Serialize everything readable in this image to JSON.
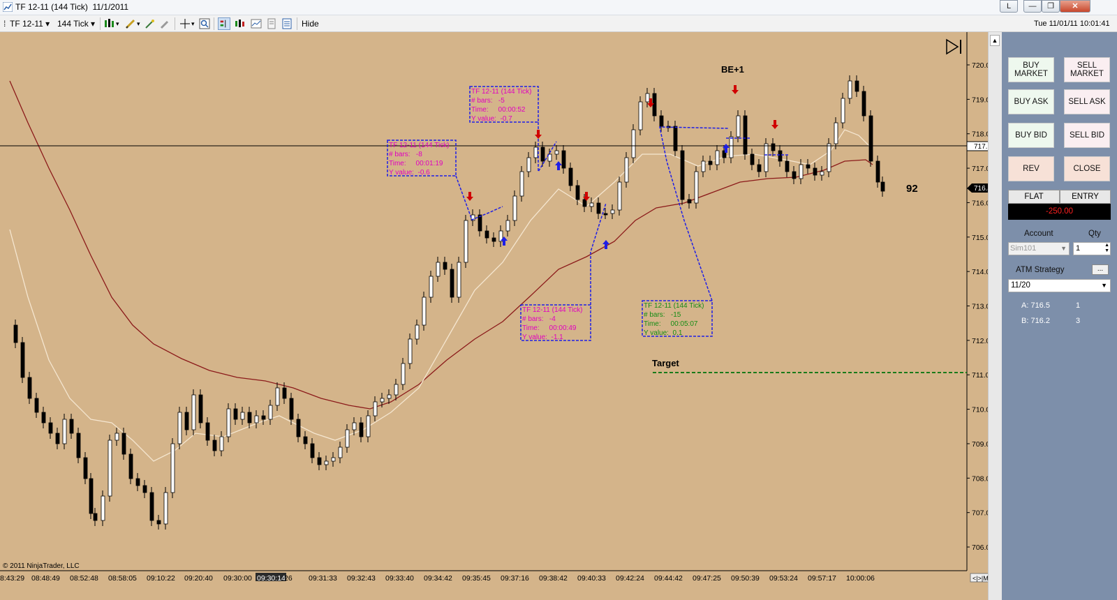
{
  "window": {
    "title": "TF 12-11 (144 Tick)  11/1/2011",
    "buttons": {
      "layout": "L",
      "minimize": "—",
      "maximize": "❐",
      "close": "✕"
    }
  },
  "toolbar": {
    "instrument": "TF 12-11",
    "interval": "144 Tick",
    "hide_label": "Hide",
    "datetime": "Tue 11/01/11 10:01:41"
  },
  "chart": {
    "copyright": "© 2011 NinjaTrader, LLC",
    "price_ticks": [
      "720.0",
      "719.0",
      "718.0",
      "717.0",
      "716.0",
      "715.0",
      "714.0",
      "713.0",
      "712.0",
      "711.0",
      "710.0",
      "709.0",
      "708.0",
      "707.0",
      "706.0"
    ],
    "time_ticks": [
      "8:43:29",
      "08:48:49",
      "08:52:48",
      "08:58:05",
      "09:10:22",
      "09:20:40",
      "09:30:00",
      "09:30:14",
      "26",
      "09:31:33",
      "09:32:43",
      "09:33:40",
      "09:34:42",
      "09:35:45",
      "09:37:16",
      "09:38:42",
      "09:40:33",
      "09:42:24",
      "09:44:42",
      "09:47:25",
      "09:50:39",
      "09:53:24",
      "09:57:17",
      "10:00:06"
    ],
    "last_price_label": "716.4",
    "hline_price_label": "717.6",
    "be_label": "BE+1",
    "target_label": "Target",
    "side_number": "92",
    "scroll_buttons": "<|>|M",
    "annotations": [
      {
        "lines": [
          "TF 12-11 (144 Tick)",
          "# bars:   -8",
          "Time:     00:01:19",
          "Y value:  -0.6"
        ],
        "color": "#e000c0"
      },
      {
        "lines": [
          "TF 12-11 (144 Tick)",
          "# bars:   -5",
          "Time:     00:00:52",
          "Y value:  -0.7"
        ],
        "color": "#e000c0"
      },
      {
        "lines": [
          "TF 12-11 (144 Tick)",
          "# bars:   -4",
          "Time:     00:00:49",
          "Y value:  -1.1"
        ],
        "color": "#e000c0"
      },
      {
        "lines": [
          "TF 12-11 (144 Tick)",
          "# bars:   -15",
          "Time:     00:05:07",
          "Y value:  0.1"
        ],
        "color": "#148c14"
      }
    ]
  },
  "panel": {
    "buy_market": "BUY MARKET",
    "sell_market": "SELL MARKET",
    "buy_ask": "BUY ASK",
    "sell_ask": "SELL ASK",
    "buy_bid": "BUY BID",
    "sell_bid": "SELL BID",
    "rev": "REV",
    "close": "CLOSE",
    "flat": "FLAT",
    "entry": "ENTRY",
    "pnl": "-250.00",
    "account_label": "Account",
    "qty_label": "Qty",
    "account_value": "Sim101",
    "qty_value": "1",
    "atm_label": "ATM Strategy",
    "atm_more": "...",
    "atm_value": "11/20",
    "ask_label": "A: 716.5",
    "ask_size": "1",
    "bid_label": "B: 716.2",
    "bid_size": "3"
  },
  "colors": {
    "chart_bg": "#d4b48a",
    "axis_bg": "#d4b48a",
    "slow_ma": "#8b1a1a",
    "fast_ma": "#f5e6d0",
    "annotation_line": "#1e1ee6",
    "target_line": "#1a7a1a",
    "panel_bg": "#7d8faa"
  }
}
